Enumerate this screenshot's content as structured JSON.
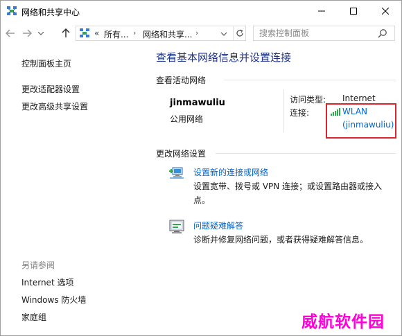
{
  "window": {
    "title": "网络和共享中心",
    "controls": {
      "minimize": "—",
      "maximize": "☐",
      "close": "✕"
    }
  },
  "address": {
    "prefix": "«",
    "segments": [
      "所有...",
      "网络和共享..."
    ],
    "separator": "›",
    "search_placeholder": "搜索控制面板"
  },
  "sidebar": {
    "home": "控制面板主页",
    "links": [
      "更改适配器设置",
      "更改高级共享设置"
    ],
    "see_also_heading": "另请参阅",
    "see_also": [
      "Internet 选项",
      "Windows 防火墙",
      "家庭组"
    ]
  },
  "main": {
    "title": "查看基本网络信息并设置连接",
    "active_networks_heading": "查看活动网络",
    "network": {
      "name": "jinmawuliu",
      "type": "公用网络",
      "access_label": "访问类型:",
      "access_value": "Internet",
      "connections_label": "连接:",
      "connection_name": "WLAN",
      "connection_ssid": "(jinmawuliu)"
    },
    "change_settings_heading": "更改网络设置",
    "tasks": [
      {
        "title": "设置新的连接或网络",
        "description": "设置宽带、拨号或 VPN 连接；或设置路由器或接入点。",
        "icon": "network-setup-icon"
      },
      {
        "title": "问题疑难解答",
        "description": "诊断并修复网络问题，或者获得疑难解答信息。",
        "icon": "troubleshoot-icon"
      }
    ]
  },
  "watermark": "威航软件园",
  "colors": {
    "title_blue": "#1e3287",
    "link_blue": "#0066cc",
    "highlight_red": "#d8262c",
    "watermark_magenta": "#ff00d8"
  }
}
